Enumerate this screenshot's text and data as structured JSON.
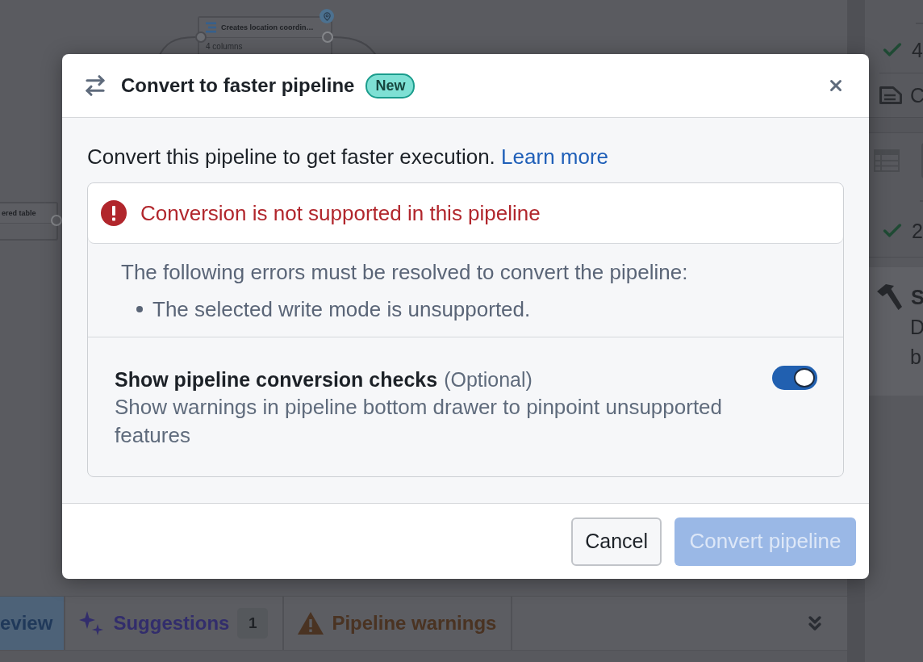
{
  "canvas": {
    "nodes": [
      {
        "kind": "transform",
        "title": "Creates location coordin…",
        "subtitle": "4 columns",
        "pinned": true
      },
      {
        "kind": "table",
        "title": "ered table",
        "pinned": false
      }
    ]
  },
  "side_panel": {
    "rows": [
      {
        "kind": "check",
        "text": "4"
      },
      {
        "kind": "doc",
        "text": "C"
      },
      {
        "kind": "table"
      },
      {
        "kind": "check",
        "text": "2"
      }
    ],
    "section": {
      "title": "S",
      "lines": [
        "D",
        "b"
      ]
    }
  },
  "bottom_drawer": {
    "tabs": [
      {
        "kind": "plain",
        "label": "eview",
        "selected": true
      },
      {
        "kind": "suggestions",
        "label": "Suggestions",
        "count": "1",
        "selected": false
      },
      {
        "kind": "warnings",
        "label": "Pipeline warnings",
        "selected": false
      }
    ]
  },
  "dialog": {
    "title": "Convert to faster pipeline",
    "badge": "New",
    "description": "Convert this pipeline to get faster execution.",
    "link": "Learn more",
    "callout": {
      "title": "Conversion is not supported in this pipeline",
      "intro": "The following errors must be resolved to convert the pipeline:",
      "errors": [
        "The selected write mode is unsupported."
      ]
    },
    "setting": {
      "label": "Show pipeline conversion checks",
      "optional": "(Optional)",
      "description": "Show warnings in pipeline bottom drawer to pinpoint unsupported features",
      "on": true
    },
    "buttons": [
      {
        "kind": "secondary",
        "label": "Cancel",
        "disabled": false
      },
      {
        "kind": "primary",
        "label": "Convert pipeline",
        "disabled": true
      }
    ]
  }
}
